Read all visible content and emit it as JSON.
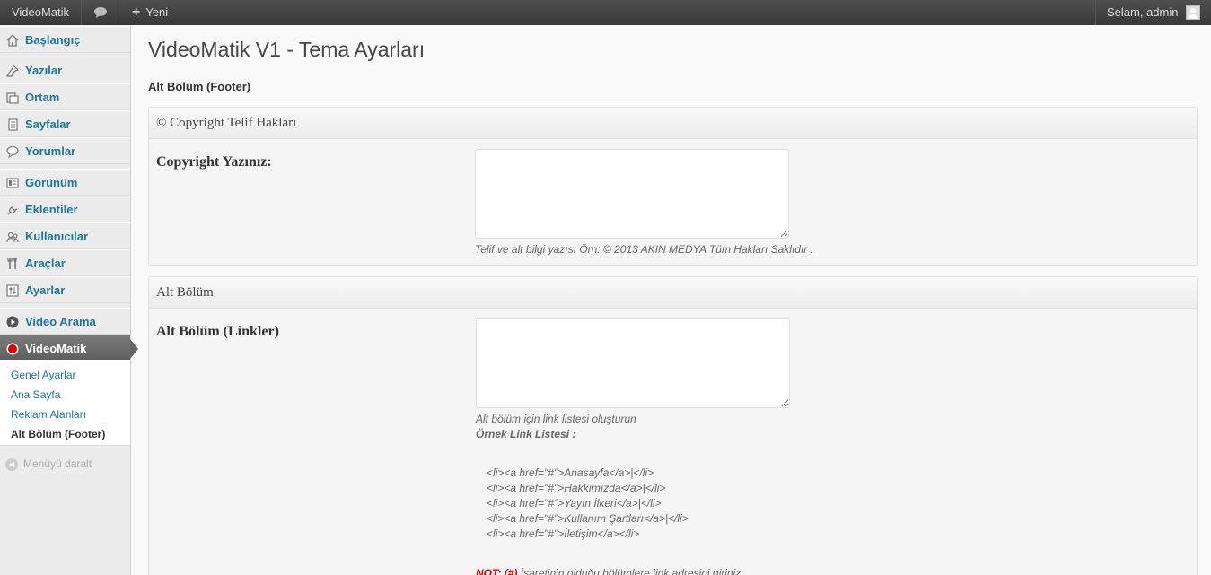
{
  "adminbar": {
    "site_name": "VideoMatik",
    "new_label": "Yeni",
    "account_label": "Selam, admin"
  },
  "sidebar": {
    "items": [
      {
        "label": "Başlangıç",
        "icon": "home-icon"
      },
      {
        "label": "Yazılar",
        "icon": "pushpin-icon"
      },
      {
        "label": "Ortam",
        "icon": "media-icon"
      },
      {
        "label": "Sayfalar",
        "icon": "pages-icon"
      },
      {
        "label": "Yorumlar",
        "icon": "comment-icon"
      },
      {
        "label": "Görünüm",
        "icon": "appearance-icon"
      },
      {
        "label": "Eklentiler",
        "icon": "plugin-icon"
      },
      {
        "label": "Kullanıcılar",
        "icon": "users-icon"
      },
      {
        "label": "Araçlar",
        "icon": "tools-icon"
      },
      {
        "label": "Ayarlar",
        "icon": "settings-icon"
      },
      {
        "label": "Video Arama",
        "icon": "play-icon"
      },
      {
        "label": "VideoMatik",
        "icon": "record-icon"
      }
    ],
    "submenu": [
      {
        "label": "Genel Ayarlar"
      },
      {
        "label": "Ana Sayfa"
      },
      {
        "label": "Reklam Alanları"
      },
      {
        "label": "Alt Bölüm (Footer)"
      }
    ],
    "collapse_label": "Menüyü daralt"
  },
  "main": {
    "title": "VideoMatik V1 - Tema Ayarları",
    "section_title": "Alt Bölüm (Footer)",
    "box1": {
      "heading": "© Copyright Telif Hakları",
      "field_label": "Copyright Yazınız:",
      "field_value": "",
      "description": "Telif ve alt bilgi yazısı Örn: © 2013 AKIN MEDYA Tüm Hakları Saklıdır ."
    },
    "box2": {
      "heading": "Alt Bölüm",
      "field_label": "Alt Bölüm (Linkler)",
      "field_value": "",
      "description": "Alt bölüm için link listesi oluşturun",
      "example_title": "Örnek Link Listesi :",
      "code_lines": [
        "<li><a href=\"#\">Anasayfa</a>|</li>",
        "<li><a href=\"#\">Hakkımızda</a>|</li>",
        "<li><a href=\"#\">Yayın İlkeri</a>|</li>",
        "<li><a href=\"#\">Kullanım Şartları</a>|</li>",
        "<li><a href=\"#\">İletişim</a></li>"
      ],
      "note_prefix": "NOT: (#)",
      "note_text": " İşaretinin olduğu bölümlere link adresini giriniz."
    }
  }
}
